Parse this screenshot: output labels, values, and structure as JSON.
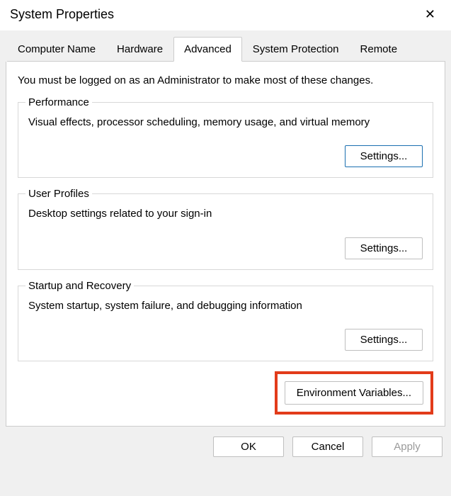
{
  "window": {
    "title": "System Properties"
  },
  "tabs": {
    "t0": "Computer Name",
    "t1": "Hardware",
    "t2": "Advanced",
    "t3": "System Protection",
    "t4": "Remote"
  },
  "admin_note": "You must be logged on as an Administrator to make most of these changes.",
  "performance": {
    "legend": "Performance",
    "desc": "Visual effects, processor scheduling, memory usage, and virtual memory",
    "settings_label": "Settings..."
  },
  "user_profiles": {
    "legend": "User Profiles",
    "desc": "Desktop settings related to your sign-in",
    "settings_label": "Settings..."
  },
  "startup_recovery": {
    "legend": "Startup and Recovery",
    "desc": "System startup, system failure, and debugging information",
    "settings_label": "Settings..."
  },
  "env_vars_label": "Environment Variables...",
  "footer": {
    "ok": "OK",
    "cancel": "Cancel",
    "apply": "Apply"
  }
}
